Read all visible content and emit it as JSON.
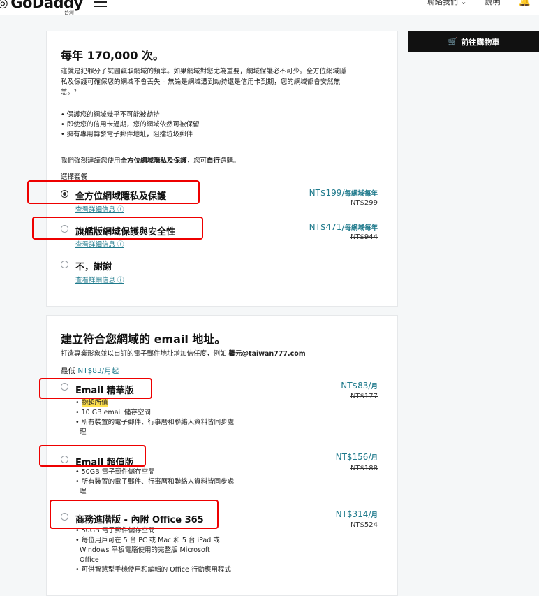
{
  "header": {
    "brand": "GoDaddy",
    "region": "台灣",
    "contact": "聯絡我們 ⌄",
    "help": "說明"
  },
  "cart": {
    "label": "前往購物車"
  },
  "protection": {
    "title": "每年 170,000 次。",
    "desc1": "這就是犯罪分子試圖竊取網域的頻率。如果網域對您尤為重要，網域保護必不可少。全方位網域隱",
    "desc2": "私及保護可確保您的網域不會丟失 – 無論是網域遭到劫持還是信用卡到期，您的網域都會安然無",
    "desc3": "恙。²",
    "bullets": [
      "保護您的網域幾乎不可能被劫持",
      "即使您的信用卡過期，您的網域依然可被保留",
      "擁有專用轉發電子郵件地址，阻擋垃圾郵件"
    ],
    "recommend_pre": "我們強烈建議您使用",
    "recommend_bold": "全方位網域隱私及保護",
    "recommend_mid": "，您可",
    "recommend_bold2": "自行",
    "recommend_post": "選購。",
    "choose": "選擇套餐",
    "options": [
      {
        "label": "全方位網域隱私及保護",
        "link": "查看詳細信息 ⓘ",
        "price": "NT$199/",
        "unit": "每網域每年",
        "old": "NT$299",
        "selected": true
      },
      {
        "label": "旗艦版網域保護與安全性",
        "link": "查看詳細信息 ⓘ",
        "price": "NT$471/",
        "unit": "每網域每年",
        "old": "NT$944",
        "selected": false
      },
      {
        "label": "不，謝謝",
        "link": "查看詳細信息 ⓘ",
        "selected": false
      }
    ]
  },
  "email": {
    "title": "建立符合您網域的 email 地址。",
    "desc_pre": "打造專業形象並以自訂的電子郵件地址增加信任度，例如 ",
    "desc_bold": "馨元@taiwan777.com",
    "from_pre": "最低 ",
    "from_price": "NT$83/月起",
    "plans": [
      {
        "label": "Email 精華版",
        "price": "NT$83/",
        "unit": "月",
        "old": "NT$177",
        "tag": "物超所值",
        "bullets": [
          "10 GB email 儲存空間",
          "所有裝置的電子郵件、行事曆和聯絡人資料皆同步處",
          "理"
        ]
      },
      {
        "label": "Email 超值版",
        "price": "NT$156/",
        "unit": "月",
        "old": "NT$188",
        "bullets": [
          "50GB 電子郵件儲存空間",
          "所有裝置的電子郵件、行事曆和聯絡人資料皆同步處",
          "理"
        ]
      },
      {
        "label": "商務進階版 - 內附 Office 365",
        "price": "NT$314/",
        "unit": "月",
        "old": "NT$524",
        "bullets": [
          "50GB 電子郵件儲存空間",
          "每位用戶可在 5 台 PC 或 Mac 和 5 台 iPad 或",
          "Windows 平板電腦使用的完整版 Microsoft",
          "Office",
          "可供智慧型手機使用和編輯的 Office 行動應用程式"
        ]
      }
    ]
  }
}
